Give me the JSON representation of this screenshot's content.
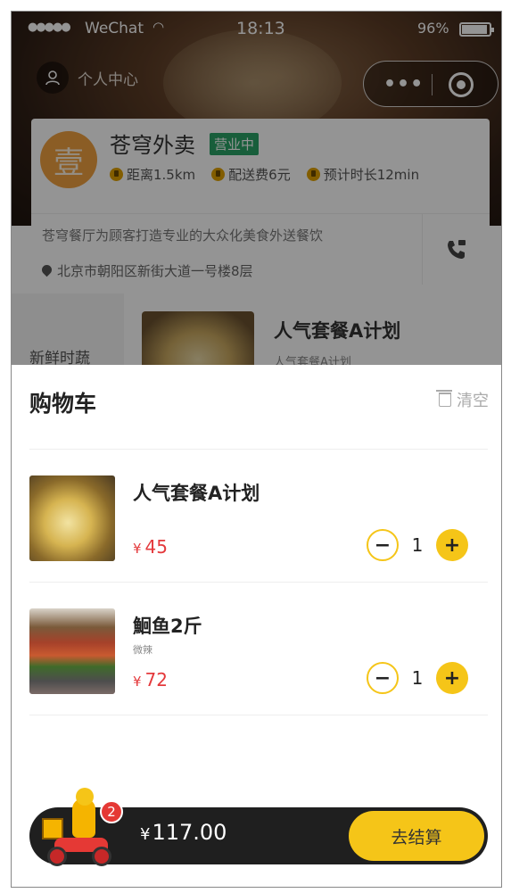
{
  "statusbar": {
    "signal": "●●●●●",
    "carrier": "WeChat",
    "time": "18:13",
    "battery": "96%"
  },
  "navbar": {
    "user_center_label": "个人中心"
  },
  "shop": {
    "logo_char": "壹",
    "name": "苍穹外卖",
    "status": "营业中",
    "distance": "距离1.5km",
    "delivery_fee": "配送费6元",
    "eta": "预计时长12min",
    "description": "苍穹餐厅为顾客打造专业的大众化美食外送餐饮",
    "address": "北京市朝阳区新街大道一号楼8层"
  },
  "menu": {
    "category": "新鲜时蔬",
    "item_title": "人气套餐A计划",
    "item_subtitle": "人气套餐A计划"
  },
  "cart": {
    "title": "购物车",
    "clear_label": "清空",
    "items": [
      {
        "name": "人气套餐A计划",
        "spec": "",
        "currency": "¥",
        "price": "45",
        "qty": "1"
      },
      {
        "name": "鮰鱼2斤",
        "spec": "微辣",
        "currency": "¥",
        "price": "72",
        "qty": "1"
      }
    ],
    "minus": "−",
    "plus": "+"
  },
  "bottom": {
    "count": "2",
    "currency": "¥",
    "total": "117.00",
    "checkout_label": "去结算"
  },
  "colors": {
    "accent": "#f5c518",
    "price": "#e4393c",
    "open_badge": "#2aa267",
    "bar": "#1f1f1f"
  },
  "icons": [
    "user-icon",
    "more-icon",
    "target-icon",
    "distance-icon",
    "fee-icon",
    "time-icon",
    "location-icon",
    "phone-icon",
    "trash-icon",
    "rider-icon"
  ]
}
